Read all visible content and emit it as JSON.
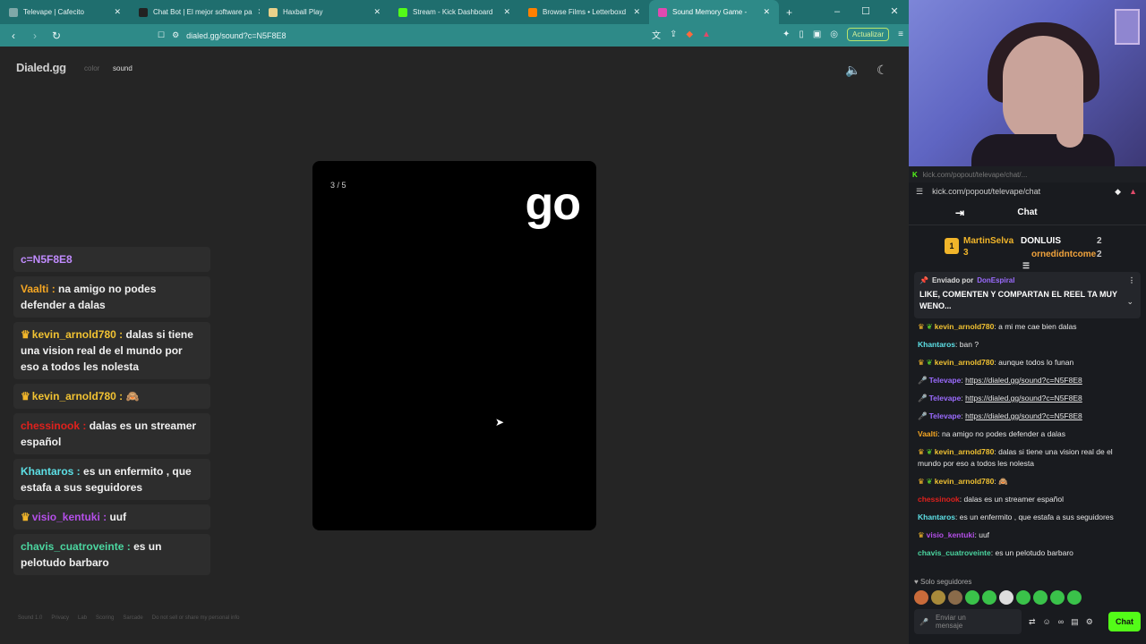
{
  "tabs": [
    {
      "label": "Televape | Cafecito",
      "icon": "globe-icon"
    },
    {
      "label": "Chat Bot | El mejor software pa",
      "icon": "bot-icon"
    },
    {
      "label": "Haxball Play",
      "icon": "haxball-icon"
    },
    {
      "label": "Stream - Kick Dashboard",
      "icon": "kick-icon"
    },
    {
      "label": "Browse Films • Letterboxd",
      "icon": "letterboxd-icon"
    },
    {
      "label": "Sound Memory Game -",
      "icon": "dialed-icon"
    }
  ],
  "new_tab": "+",
  "window_controls": {
    "minimize": "–",
    "maximize": "☐",
    "close": "✕"
  },
  "address": {
    "url": "dialed.gg/sound?c=N5F8E8",
    "update_label": "Actualizar"
  },
  "site": {
    "logo": "Dialed.gg",
    "nav_color": "color",
    "nav_sound": "sound",
    "counter": "3 / 5",
    "word": "go",
    "footer": [
      "Sound 1.0",
      "Privacy",
      "Lab",
      "Scoring",
      "Sarcade",
      "Do not sell or share my personal info"
    ]
  },
  "overlay_chat": [
    {
      "user": "",
      "text": "c=N5F8E8",
      "user_color": "#c18cff"
    },
    {
      "user": "Vaalti",
      "text": "na amigo no podes defender a dalas",
      "user_color": "#f5a623"
    },
    {
      "user": "kevin_arnold780",
      "text": "dalas si tiene una vision real de el mundo por eso a todos les nolesta",
      "user_color": "#f1c232"
    },
    {
      "user": "kevin_arnold780",
      "text": "",
      "user_color": "#f1c232"
    },
    {
      "user": "chessinook",
      "text": "dalas es un streamer español",
      "user_color": "#e0211d"
    },
    {
      "user": "Khantaros",
      "text": "es un enfermito , que estafa a sus seguidores",
      "user_color": "#5de0e6"
    },
    {
      "user": "visio_kentuki",
      "text": "uuf",
      "user_color": "#b44fe8"
    },
    {
      "user": "chavis_cuatroveinte",
      "text": "es un pelotudo barbaro",
      "user_color": "#4bd6a0"
    }
  ],
  "kick_chat": {
    "window_title": "kick.com/popout/televape/chat/...",
    "url": "kick.com/popout/televape/chat",
    "header": "Chat",
    "leaderboard": [
      {
        "name": "MartinSelva",
        "count": "3",
        "color": "#f1b52a"
      },
      {
        "name": "DONLUIS",
        "count": "2",
        "color": "#ffffff"
      },
      {
        "name": "ornedidntcome",
        "count": "2",
        "color": "#f1a33c"
      }
    ],
    "pinned": {
      "by_label": "Enviado por",
      "by_user": "DonEspiral",
      "text": "LIKE, COMENTEN Y COMPARTAN EL REEL TA MUY WENO..."
    },
    "messages": [
      {
        "user": "kevin_arnold780",
        "text": "a mi me cae bien dalas",
        "color": "#f1c232",
        "badges": "crown"
      },
      {
        "user": "Khantaros",
        "text": "ban ?",
        "color": "#5de0e6",
        "badges": ""
      },
      {
        "user": "kevin_arnold780",
        "text": "aunque todos lo funan",
        "color": "#f1c232",
        "badges": "crown"
      },
      {
        "user": "Televape",
        "text": "https://dialed.gg/sound?c=N5F8E8",
        "color": "#9b6bff",
        "badges": "mic"
      },
      {
        "user": "Televape",
        "text": "https://dialed.gg/sound?c=N5F8E8",
        "color": "#9b6bff",
        "badges": "mic"
      },
      {
        "user": "Televape",
        "text": "https://dialed.gg/sound?c=N5F8E8",
        "color": "#9b6bff",
        "badges": "mic"
      },
      {
        "user": "Vaalti",
        "text": "na amigo no podes defender a dalas",
        "color": "#f5a623",
        "badges": ""
      },
      {
        "user": "kevin_arnold780",
        "text": "dalas si tiene una vision real de el mundo por eso a todos les nolesta",
        "color": "#f1c232",
        "badges": "crown"
      },
      {
        "user": "kevin_arnold780",
        "text": "",
        "color": "#f1c232",
        "badges": "crown"
      },
      {
        "user": "chessinook",
        "text": "dalas es un streamer español",
        "color": "#e0211d",
        "badges": ""
      },
      {
        "user": "Khantaros",
        "text": "es un enfermito , que estafa a sus seguidores",
        "color": "#5de0e6",
        "badges": ""
      },
      {
        "user": "visio_kentuki",
        "text": "uuf",
        "color": "#b44fe8",
        "badges": "crown"
      },
      {
        "user": "chavis_cuatroveinte",
        "text": "es un pelotudo barbaro",
        "color": "#4bd6a0",
        "badges": ""
      }
    ],
    "followers_only": "Solo seguidores",
    "input_placeholder": "Enviar un mensaje",
    "send_label": "Chat"
  }
}
